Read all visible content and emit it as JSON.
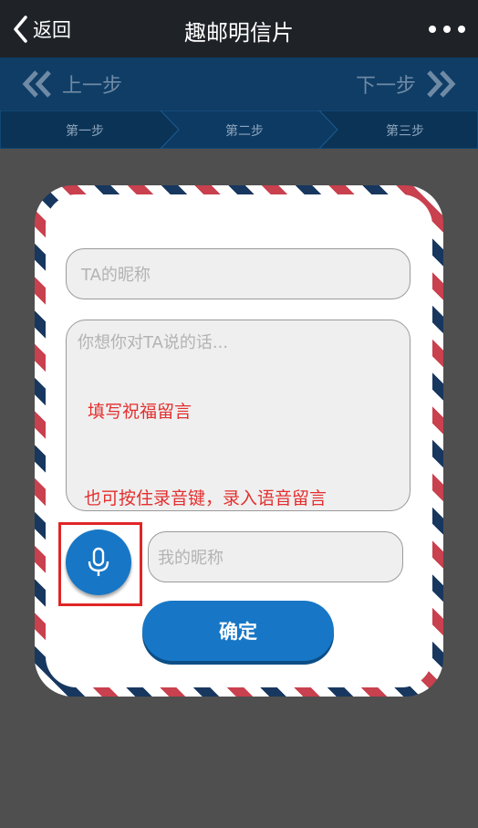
{
  "header": {
    "back_label": "返回",
    "title": "趣邮明信片",
    "back_icon": "chevron-left-icon",
    "more_icon": "more-dots-icon"
  },
  "stepnav": {
    "prev_label": "上一步",
    "next_label": "下一步",
    "steps": [
      "第一步",
      "第二步",
      "第三步"
    ],
    "active_step": 2
  },
  "form": {
    "ta_nickname_placeholder": "TA的昵称",
    "message_placeholder": "你想你对TA说的话...",
    "my_nickname_placeholder": "我的昵称",
    "confirm_label": "确定",
    "mic_icon": "microphone-icon"
  },
  "annotations": {
    "line1": "填写祝福留言",
    "line2": "也可按住录音键，录入语音留言"
  },
  "colors": {
    "primary_blue": "#1777c6",
    "annotation_red": "#e42f2f",
    "airmail_red": "#c9404e",
    "airmail_navy": "#17375f"
  }
}
